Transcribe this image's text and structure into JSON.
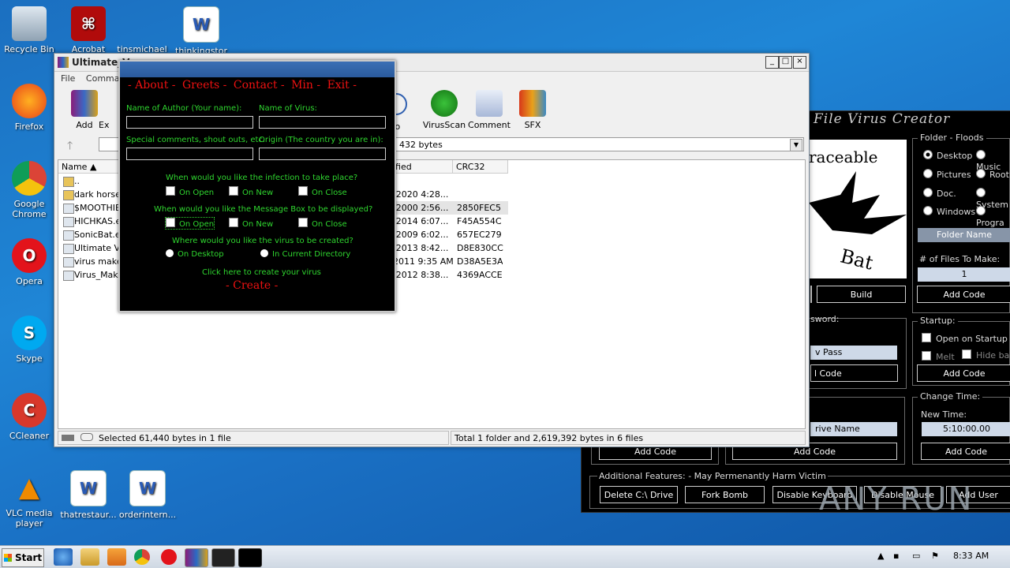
{
  "desktop": {
    "icons": [
      {
        "label": "Recycle Bin"
      },
      {
        "label": "Acrobat"
      },
      {
        "label": "tinsmichael"
      },
      {
        "label": "thinkingstor"
      },
      {
        "label": "Firefox"
      },
      {
        "label": "Google Chrome"
      },
      {
        "label": "Opera"
      },
      {
        "label": "Skype"
      },
      {
        "label": "CCleaner"
      },
      {
        "label": "VLC media player"
      },
      {
        "label": "thatrestaur..."
      },
      {
        "label": "orderintern..."
      }
    ]
  },
  "winrar": {
    "title": "Ultimate_V",
    "menu": [
      "File",
      "Command"
    ],
    "tools": [
      {
        "label": "Add"
      },
      {
        "label": "Ex"
      },
      {
        "label": "fo"
      },
      {
        "label": "VirusScan"
      },
      {
        "label": "Comment"
      },
      {
        "label": "SFX"
      }
    ],
    "address": "432 bytes",
    "columns": {
      "name": "Name",
      "modified": "ified",
      "crc": "CRC32"
    },
    "rows": [
      {
        "name": "..",
        "modified": "",
        "crc": ""
      },
      {
        "name": "dark horse (",
        "modified": "/2020 4:28...",
        "crc": ""
      },
      {
        "name": "$MOOTHIE's",
        "modified": "/2000 2:56...",
        "crc": "2850FEC5"
      },
      {
        "name": "HICHKAS.ex",
        "modified": "/2014 6:07...",
        "crc": "F45A554C"
      },
      {
        "name": "SonicBat.ex",
        "modified": "/2009 6:02...",
        "crc": "657EC279"
      },
      {
        "name": "Ultimate Viru",
        "modified": "/2013 8:42...",
        "crc": "D8E830CC"
      },
      {
        "name": "virus maker.",
        "modified": "2011 9:35 AM",
        "crc": "D38A5E3A"
      },
      {
        "name": "Virus_Maker",
        "modified": "/2012 8:38...",
        "crc": "4369ACCE"
      }
    ],
    "status_left": "Selected 61,440 bytes in 1 file",
    "status_right": "Total 1 folder and 2,619,392 bytes in 6 files"
  },
  "sonic": {
    "header": "File Virus Creator",
    "logo_top": "raceable",
    "logo_bottom": "Bat",
    "folder_floods": {
      "title": "Folder - Floods",
      "options": [
        "Desktop",
        "Music",
        "Pictures",
        "Root",
        "Doc.",
        "System",
        "Windows",
        "Progra"
      ],
      "folder_name": "Folder Name",
      "files_label": "# of Files To Make:",
      "files_value": "1",
      "add_code": "Add Code"
    },
    "build": "Build",
    "password_label": "sword:",
    "pass_field": "v Pass",
    "pass_code": "l Code",
    "startup": {
      "title": "Startup:",
      "open_on_startup": "Open on Startup",
      "melt": "Melt",
      "hide": "Hide ba",
      "add_code": "Add Code"
    },
    "change_time": {
      "title": "Change Time:",
      "new_time_label": "New Time:",
      "new_time_value": "5:10:00.00",
      "add_code": "Add Code"
    },
    "drive_name": "rive Name",
    "add_code_a": "Add Code",
    "add_code_b": "Add Code",
    "additional": {
      "title": "Additional Features:  - May Permenantly Harm Victim",
      "buttons": [
        "Delete C:\\ Drive",
        "Fork Bomb",
        "Disable Keyboard",
        "Disable Mouse",
        "Add User"
      ]
    }
  },
  "uvm": {
    "nav": [
      "- About -",
      "Greets -",
      "Contact -",
      "Min -",
      "Exit -"
    ],
    "author_label": "Name of Author (Your name):",
    "virus_label": "Name of Virus:",
    "comments_label": "Special comments, shout outs, etc.",
    "origin_label": "Origin (The country you are in):",
    "infection_q": "When would you like the infection to take place?",
    "infection_opts": [
      "On Open",
      "On New",
      "On Close"
    ],
    "msgbox_q": "When would you like the Message Box to be displayed?",
    "msgbox_opts": [
      "On Open",
      "On New",
      "On Close"
    ],
    "where_q": "Where would you like the virus to be created?",
    "where_opts": [
      "On Desktop",
      "In Current Directory"
    ],
    "click_here": "Click here to create your virus",
    "create": "- Create -"
  },
  "taskbar": {
    "start": "Start",
    "time": "8:33 AM"
  },
  "watermark": "ANY RUN"
}
